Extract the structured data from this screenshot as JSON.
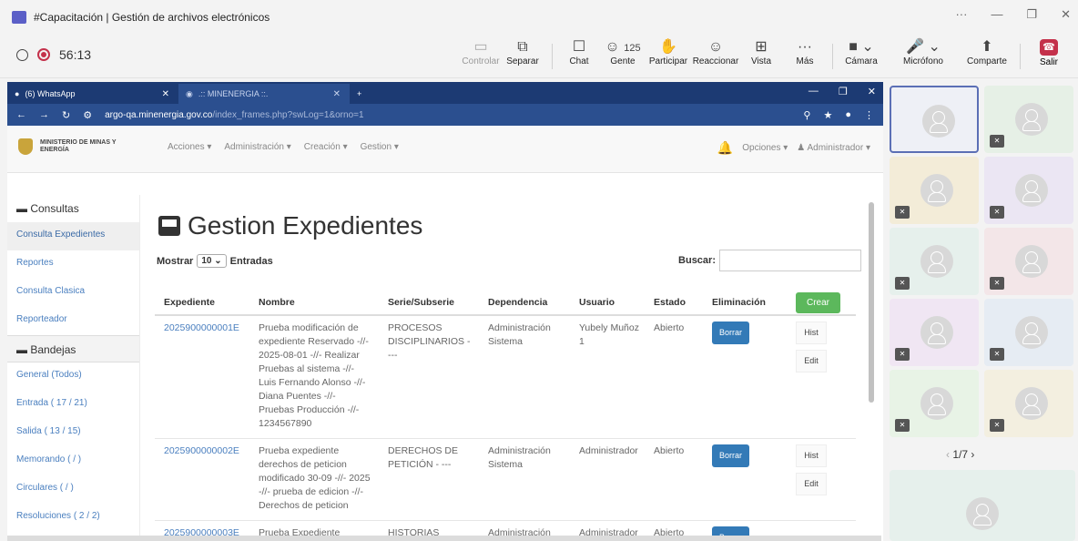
{
  "teams": {
    "title": "#Capacitación | Gestión de archivos electrónicos",
    "timer": "56:13",
    "people_count": "125",
    "toolbar": [
      {
        "label": "Controlar",
        "icon": "control-icon"
      },
      {
        "label": "Separar",
        "icon": "popout-icon"
      },
      {
        "label": "Chat",
        "icon": "chat-icon"
      },
      {
        "label": "Gente",
        "icon": "people-icon"
      },
      {
        "label": "Participar",
        "icon": "raise-hand-icon"
      },
      {
        "label": "Reaccionar",
        "icon": "react-icon"
      },
      {
        "label": "Vista",
        "icon": "view-icon"
      },
      {
        "label": "Más",
        "icon": "more-icon"
      },
      {
        "label": "Cámara",
        "icon": "camera-off-icon"
      },
      {
        "label": "Micrófono",
        "icon": "mic-off-icon"
      },
      {
        "label": "Comparte",
        "icon": "share-icon"
      },
      {
        "label": "Salir",
        "icon": "leave-icon"
      }
    ]
  },
  "chrome": {
    "tab1": "(6) WhatsApp",
    "tab2": ".:: MINENERGIA ::.",
    "url_host": "argo-qa.minenergia.gov.co",
    "url_path": "/index_frames.php?swLog=1&orno=1"
  },
  "site": {
    "brand": "MINISTERIO DE MINAS Y ENERGÍA",
    "menu": [
      "Acciones ▾",
      "Administración ▾",
      "Creación ▾",
      "Gestion ▾"
    ],
    "opciones": "Opciones ▾",
    "admin": "Administrador ▾"
  },
  "sidebar": {
    "consultas": "Consultas",
    "items1": [
      "Consulta Expedientes",
      "Reportes",
      "Consulta Clasica",
      "Reporteador"
    ],
    "bandejas": "Bandejas",
    "items2": [
      "General (Todos)",
      "Entrada ( 17 / 21)",
      "Salida ( 13 / 15)",
      "Memorando ( / )",
      "Circulares ( / )",
      "Resoluciones ( 2 / 2)"
    ]
  },
  "main": {
    "title": "Gestion Expedientes",
    "mostrar": "Mostrar",
    "entries": "10",
    "entradas": "Entradas",
    "buscar": "Buscar:",
    "crear": "Crear",
    "headers": [
      "Expediente",
      "Nombre",
      "Serie/Subserie",
      "Dependencia",
      "Usuario",
      "Estado",
      "Eliminación"
    ],
    "borrar": "Borrar",
    "hist": "Hist",
    "edit": "Edit",
    "rows": [
      {
        "exp": "2025900000001E",
        "nombre": "Prueba modificación de expediente Reservado -//- 2025-08-01 -//- Realizar Pruebas al sistema -//- Luis Fernando Alonso -//- Diana Puentes -//- Pruebas Producción -//- 1234567890",
        "serie": "PROCESOS DISCIPLINARIOS - ---",
        "dep": "Administración Sistema",
        "user": "Yubely Muñoz 1",
        "estado": "Abierto"
      },
      {
        "exp": "2025900000002E",
        "nombre": "Prueba expediente derechos de peticion modificado 30-09 -//- 2025 -//- prueba de edicion -//- Derechos de peticion",
        "serie": "DERECHOS DE PETICIÓN - ---",
        "dep": "Administración Sistema",
        "user": "Administrador",
        "estado": "Abierto"
      },
      {
        "exp": "2025900000003E",
        "nombre": "Prueba Expediente",
        "serie": "HISTORIAS",
        "dep": "Administración",
        "user": "Administrador",
        "estado": "Abierto"
      }
    ]
  },
  "gallery": {
    "page": "1/7"
  }
}
